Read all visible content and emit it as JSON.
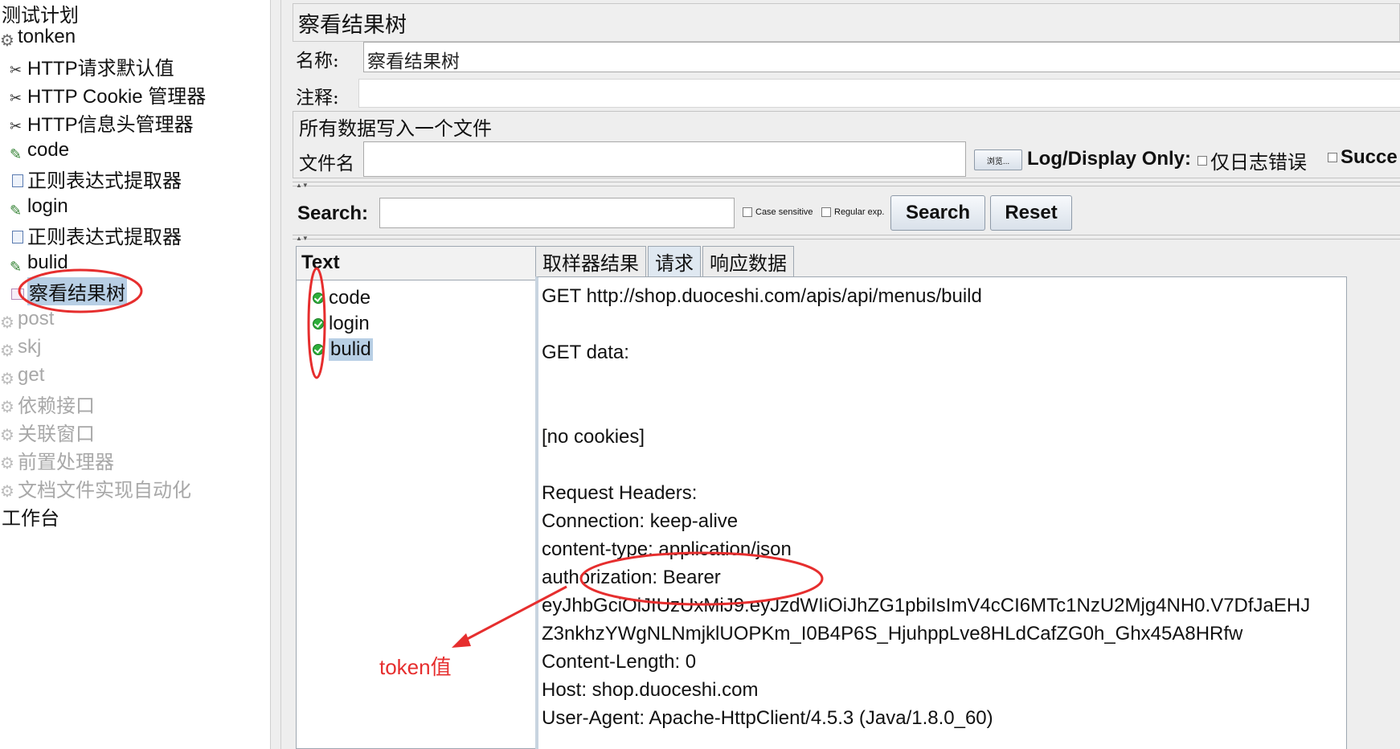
{
  "tree": {
    "items": [
      {
        "label": "测试计划",
        "icon": "plan-icon",
        "state": "normal"
      },
      {
        "label": "tonken",
        "icon": "thread-group-gear-icon",
        "state": "normal"
      },
      {
        "label": "HTTP请求默认值",
        "icon": "config-scissors-icon",
        "state": "normal"
      },
      {
        "label": "HTTP Cookie 管理器",
        "icon": "config-scissors-icon",
        "state": "normal"
      },
      {
        "label": "HTTP信息头管理器",
        "icon": "config-scissors-icon",
        "state": "normal"
      },
      {
        "label": "code",
        "icon": "sampler-pen-icon",
        "state": "normal"
      },
      {
        "label": "正则表达式提取器",
        "icon": "extractor-icon",
        "state": "normal"
      },
      {
        "label": "login",
        "icon": "sampler-pen-icon",
        "state": "normal"
      },
      {
        "label": "正则表达式提取器",
        "icon": "extractor-icon",
        "state": "normal"
      },
      {
        "label": "bulid",
        "icon": "sampler-pen-icon",
        "state": "normal"
      },
      {
        "label": "察看结果树",
        "icon": "listener-graph-icon",
        "state": "selected"
      },
      {
        "label": "post",
        "icon": "thread-group-gear-icon",
        "state": "disabled"
      },
      {
        "label": "skj",
        "icon": "thread-group-gear-icon",
        "state": "disabled"
      },
      {
        "label": "get",
        "icon": "thread-group-gear-icon",
        "state": "disabled"
      },
      {
        "label": "依赖接口",
        "icon": "thread-group-gear-icon",
        "state": "disabled"
      },
      {
        "label": "关联窗口",
        "icon": "thread-group-gear-icon",
        "state": "disabled"
      },
      {
        "label": "前置处理器",
        "icon": "thread-group-gear-icon",
        "state": "disabled"
      },
      {
        "label": "文档文件实现自动化",
        "icon": "thread-group-gear-icon",
        "state": "disabled"
      },
      {
        "label": "工作台",
        "icon": "workbench-icon",
        "state": "normal"
      }
    ]
  },
  "panel": {
    "title": "察看结果树",
    "name_label": "名称:",
    "name_value": "察看结果树",
    "comment_label": "注释:",
    "comment_value": "",
    "file_group_title": "所有数据写入一个文件",
    "filename_label": "文件名",
    "filename_value": "",
    "browse_label": "浏览...",
    "log_display_label": "Log/Display Only:",
    "errors_only_label": "仅日志错误",
    "success_label": "Succe"
  },
  "search": {
    "label": "Search:",
    "value": "",
    "case_sensitive": "Case sensitive",
    "regular_exp": "Regular exp.",
    "search_button": "Search",
    "reset_button": "Reset"
  },
  "results": {
    "renderer": "Text",
    "samples": [
      {
        "label": "code",
        "status": "ok",
        "selected": false
      },
      {
        "label": "login",
        "status": "ok",
        "selected": false
      },
      {
        "label": "bulid",
        "status": "ok",
        "selected": true
      }
    ]
  },
  "tabs": [
    {
      "label": "取样器结果",
      "active": false
    },
    {
      "label": "请求",
      "active": true
    },
    {
      "label": "响应数据",
      "active": false
    }
  ],
  "request_lines": [
    "GET http://shop.duoceshi.com/apis/api/menus/build",
    "",
    "GET data:",
    "",
    "",
    "[no cookies]",
    "",
    "Request Headers:",
    "Connection: keep-alive",
    "content-type: application/json",
    "authorization: Bearer",
    "eyJhbGciOiJIUzUxMiJ9.eyJzdWIiOiJhZG1pbiIsImV4cCI6MTc1NzU2Mjg4NH0.V7DfJaEHJ",
    "Z3nkhzYWgNLNmjklUOPKm_I0B4P6S_HjuhppLve8HLdCafZG0h_Ghx45A8HRfw",
    "Content-Length: 0",
    "Host: shop.duoceshi.com",
    "User-Agent: Apache-HttpClient/4.5.3 (Java/1.8.0_60)"
  ],
  "annotation": {
    "token_label": "token值",
    "color": "#e62e2e"
  },
  "colors": {
    "selection": "#b8cfe5",
    "ok_icon": "#2eae3a",
    "panel_bg": "#eeeeee"
  }
}
